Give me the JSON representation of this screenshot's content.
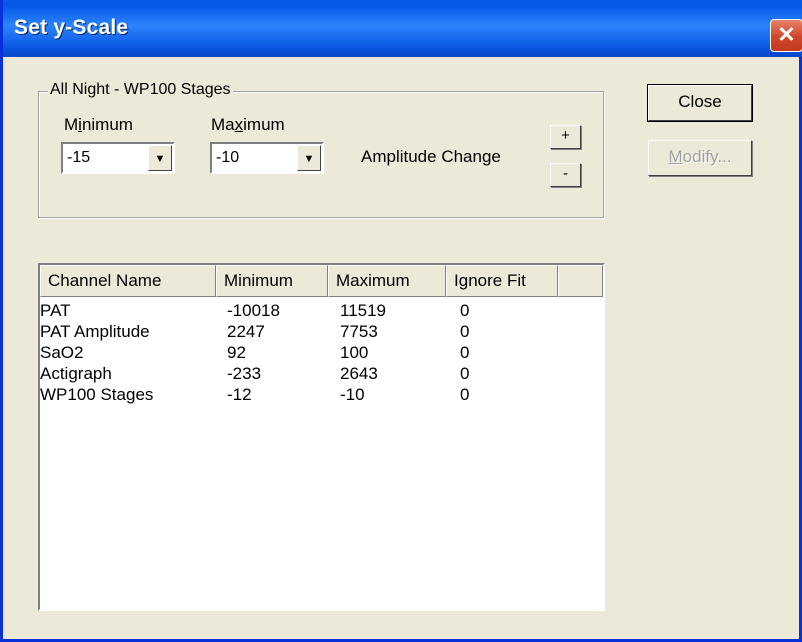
{
  "window": {
    "title": "Set y-Scale",
    "close_glyph": "✕"
  },
  "group": {
    "legend": "All Night - WP100 Stages",
    "minimum_label_pre": "M",
    "minimum_label_u": "i",
    "minimum_label_post": "nimum",
    "maximum_label_pre": "Ma",
    "maximum_label_u": "x",
    "maximum_label_post": "imum",
    "minimum_value": "-15",
    "maximum_value": "-10",
    "amplitude_label": "Amplitude Change",
    "plus_label": "+",
    "minus_label": "-"
  },
  "buttons": {
    "close_label": "Close",
    "modify_label_u": "M",
    "modify_label_post": "odify..."
  },
  "table": {
    "columns": [
      "Channel Name",
      "Minimum",
      "Maximum",
      "Ignore Fit"
    ],
    "ignore_fit_pre": "I",
    "ignore_fit_u": "g",
    "ignore_fit_post": "nore Fit",
    "rows": [
      {
        "name": "PAT",
        "min": "-10018",
        "max": "11519",
        "ignore": "0"
      },
      {
        "name": "PAT Amplitude",
        "min": "2247",
        "max": "7753",
        "ignore": "0"
      },
      {
        "name": "SaO2",
        "min": "92",
        "max": "100",
        "ignore": "0"
      },
      {
        "name": "Actigraph",
        "min": "-233",
        "max": "2643",
        "ignore": "0"
      },
      {
        "name": "WP100 Stages",
        "min": "-12",
        "max": "-10",
        "ignore": "0"
      }
    ]
  },
  "icons": {
    "dropdown_arrow": "▼"
  }
}
